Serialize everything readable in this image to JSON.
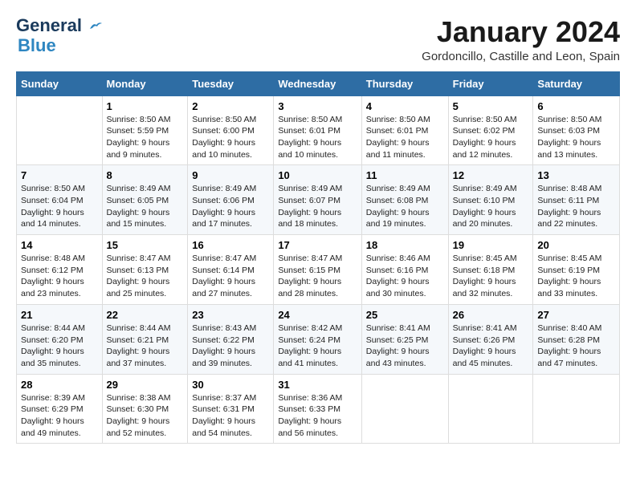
{
  "header": {
    "logo_line1": "General",
    "logo_line2": "Blue",
    "month_title": "January 2024",
    "subtitle": "Gordoncillo, Castille and Leon, Spain"
  },
  "weekdays": [
    "Sunday",
    "Monday",
    "Tuesday",
    "Wednesday",
    "Thursday",
    "Friday",
    "Saturday"
  ],
  "weeks": [
    [
      {
        "day": "",
        "sunrise": "",
        "sunset": "",
        "daylight": ""
      },
      {
        "day": "1",
        "sunrise": "Sunrise: 8:50 AM",
        "sunset": "Sunset: 5:59 PM",
        "daylight": "Daylight: 9 hours and 9 minutes."
      },
      {
        "day": "2",
        "sunrise": "Sunrise: 8:50 AM",
        "sunset": "Sunset: 6:00 PM",
        "daylight": "Daylight: 9 hours and 10 minutes."
      },
      {
        "day": "3",
        "sunrise": "Sunrise: 8:50 AM",
        "sunset": "Sunset: 6:01 PM",
        "daylight": "Daylight: 9 hours and 10 minutes."
      },
      {
        "day": "4",
        "sunrise": "Sunrise: 8:50 AM",
        "sunset": "Sunset: 6:01 PM",
        "daylight": "Daylight: 9 hours and 11 minutes."
      },
      {
        "day": "5",
        "sunrise": "Sunrise: 8:50 AM",
        "sunset": "Sunset: 6:02 PM",
        "daylight": "Daylight: 9 hours and 12 minutes."
      },
      {
        "day": "6",
        "sunrise": "Sunrise: 8:50 AM",
        "sunset": "Sunset: 6:03 PM",
        "daylight": "Daylight: 9 hours and 13 minutes."
      }
    ],
    [
      {
        "day": "7",
        "sunrise": "Sunrise: 8:50 AM",
        "sunset": "Sunset: 6:04 PM",
        "daylight": "Daylight: 9 hours and 14 minutes."
      },
      {
        "day": "8",
        "sunrise": "Sunrise: 8:49 AM",
        "sunset": "Sunset: 6:05 PM",
        "daylight": "Daylight: 9 hours and 15 minutes."
      },
      {
        "day": "9",
        "sunrise": "Sunrise: 8:49 AM",
        "sunset": "Sunset: 6:06 PM",
        "daylight": "Daylight: 9 hours and 17 minutes."
      },
      {
        "day": "10",
        "sunrise": "Sunrise: 8:49 AM",
        "sunset": "Sunset: 6:07 PM",
        "daylight": "Daylight: 9 hours and 18 minutes."
      },
      {
        "day": "11",
        "sunrise": "Sunrise: 8:49 AM",
        "sunset": "Sunset: 6:08 PM",
        "daylight": "Daylight: 9 hours and 19 minutes."
      },
      {
        "day": "12",
        "sunrise": "Sunrise: 8:49 AM",
        "sunset": "Sunset: 6:10 PM",
        "daylight": "Daylight: 9 hours and 20 minutes."
      },
      {
        "day": "13",
        "sunrise": "Sunrise: 8:48 AM",
        "sunset": "Sunset: 6:11 PM",
        "daylight": "Daylight: 9 hours and 22 minutes."
      }
    ],
    [
      {
        "day": "14",
        "sunrise": "Sunrise: 8:48 AM",
        "sunset": "Sunset: 6:12 PM",
        "daylight": "Daylight: 9 hours and 23 minutes."
      },
      {
        "day": "15",
        "sunrise": "Sunrise: 8:47 AM",
        "sunset": "Sunset: 6:13 PM",
        "daylight": "Daylight: 9 hours and 25 minutes."
      },
      {
        "day": "16",
        "sunrise": "Sunrise: 8:47 AM",
        "sunset": "Sunset: 6:14 PM",
        "daylight": "Daylight: 9 hours and 27 minutes."
      },
      {
        "day": "17",
        "sunrise": "Sunrise: 8:47 AM",
        "sunset": "Sunset: 6:15 PM",
        "daylight": "Daylight: 9 hours and 28 minutes."
      },
      {
        "day": "18",
        "sunrise": "Sunrise: 8:46 AM",
        "sunset": "Sunset: 6:16 PM",
        "daylight": "Daylight: 9 hours and 30 minutes."
      },
      {
        "day": "19",
        "sunrise": "Sunrise: 8:45 AM",
        "sunset": "Sunset: 6:18 PM",
        "daylight": "Daylight: 9 hours and 32 minutes."
      },
      {
        "day": "20",
        "sunrise": "Sunrise: 8:45 AM",
        "sunset": "Sunset: 6:19 PM",
        "daylight": "Daylight: 9 hours and 33 minutes."
      }
    ],
    [
      {
        "day": "21",
        "sunrise": "Sunrise: 8:44 AM",
        "sunset": "Sunset: 6:20 PM",
        "daylight": "Daylight: 9 hours and 35 minutes."
      },
      {
        "day": "22",
        "sunrise": "Sunrise: 8:44 AM",
        "sunset": "Sunset: 6:21 PM",
        "daylight": "Daylight: 9 hours and 37 minutes."
      },
      {
        "day": "23",
        "sunrise": "Sunrise: 8:43 AM",
        "sunset": "Sunset: 6:22 PM",
        "daylight": "Daylight: 9 hours and 39 minutes."
      },
      {
        "day": "24",
        "sunrise": "Sunrise: 8:42 AM",
        "sunset": "Sunset: 6:24 PM",
        "daylight": "Daylight: 9 hours and 41 minutes."
      },
      {
        "day": "25",
        "sunrise": "Sunrise: 8:41 AM",
        "sunset": "Sunset: 6:25 PM",
        "daylight": "Daylight: 9 hours and 43 minutes."
      },
      {
        "day": "26",
        "sunrise": "Sunrise: 8:41 AM",
        "sunset": "Sunset: 6:26 PM",
        "daylight": "Daylight: 9 hours and 45 minutes."
      },
      {
        "day": "27",
        "sunrise": "Sunrise: 8:40 AM",
        "sunset": "Sunset: 6:28 PM",
        "daylight": "Daylight: 9 hours and 47 minutes."
      }
    ],
    [
      {
        "day": "28",
        "sunrise": "Sunrise: 8:39 AM",
        "sunset": "Sunset: 6:29 PM",
        "daylight": "Daylight: 9 hours and 49 minutes."
      },
      {
        "day": "29",
        "sunrise": "Sunrise: 8:38 AM",
        "sunset": "Sunset: 6:30 PM",
        "daylight": "Daylight: 9 hours and 52 minutes."
      },
      {
        "day": "30",
        "sunrise": "Sunrise: 8:37 AM",
        "sunset": "Sunset: 6:31 PM",
        "daylight": "Daylight: 9 hours and 54 minutes."
      },
      {
        "day": "31",
        "sunrise": "Sunrise: 8:36 AM",
        "sunset": "Sunset: 6:33 PM",
        "daylight": "Daylight: 9 hours and 56 minutes."
      },
      {
        "day": "",
        "sunrise": "",
        "sunset": "",
        "daylight": ""
      },
      {
        "day": "",
        "sunrise": "",
        "sunset": "",
        "daylight": ""
      },
      {
        "day": "",
        "sunrise": "",
        "sunset": "",
        "daylight": ""
      }
    ]
  ]
}
